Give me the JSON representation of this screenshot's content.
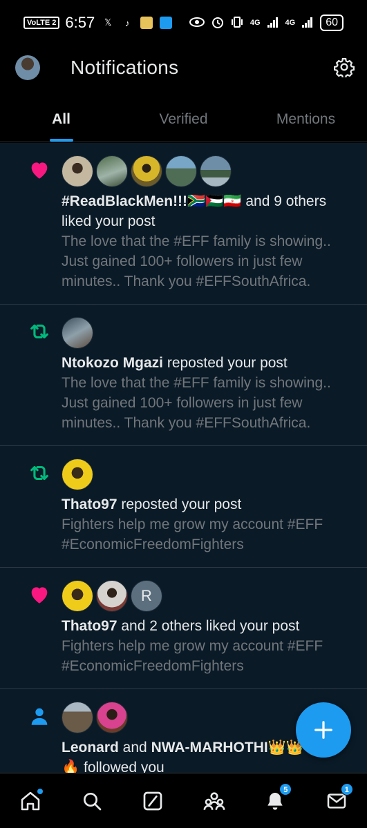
{
  "status_bar": {
    "volte": "VoLTE 2",
    "time": "6:57",
    "net1": "4G",
    "net2": "4G",
    "battery": "60",
    "app_icons": [
      "x-icon",
      "tiktok-icon",
      "app-icon",
      "messenger-icon"
    ],
    "right_icons": [
      "eye-icon",
      "alarm-icon",
      "vibrate-icon",
      "signal-icon",
      "signal-icon"
    ]
  },
  "header": {
    "title": "Notifications"
  },
  "tabs": [
    {
      "label": "All",
      "active": true
    },
    {
      "label": "Verified",
      "active": false
    },
    {
      "label": "Mentions",
      "active": false
    }
  ],
  "notifications": [
    {
      "type": "like",
      "icon": "heart-icon",
      "actor": "#ReadBlackMen!!!🇿🇦🇵🇸🇮🇷",
      "rest": " and 9 others liked your post",
      "snippet": "The love that the #EFF family is showing.. Just gained 100+ followers in just few minutes.. Thank you #EFFSouthAfrica."
    },
    {
      "type": "repost",
      "icon": "repost-icon",
      "actor": "Ntokozo Mgazi",
      "rest": " reposted your post",
      "snippet": "The love that the #EFF family is showing.. Just gained 100+ followers in just few minutes.. Thank you #EFFSouthAfrica."
    },
    {
      "type": "repost",
      "icon": "repost-icon",
      "actor": "Thato97",
      "rest": " reposted your post",
      "snippet": "Fighters help me grow my account #EFF #EconomicFreedomFighters"
    },
    {
      "type": "like",
      "icon": "heart-icon",
      "actor": "Thato97",
      "rest": " and 2 others liked your post",
      "snippet": "Fighters help me grow my account #EFF #EconomicFreedomFighters",
      "letter_avatar": "R"
    },
    {
      "type": "follow",
      "icon": "person-icon",
      "actor": "Leonard",
      "mid": " and ",
      "actor2": "NWA-MARHOTHI👑👑🔥🔥🔥",
      "rest": " followed you"
    }
  ],
  "bottom_nav": {
    "items": [
      "home-icon",
      "search-icon",
      "grok-icon",
      "communities-icon",
      "notifications-icon",
      "messages-icon"
    ],
    "notifications_badge": "5",
    "messages_badge": "1"
  },
  "colors": {
    "accent": "#1d9bf0",
    "like": "#f91880",
    "repost": "#00ba7c",
    "background": "#0a1a27"
  }
}
